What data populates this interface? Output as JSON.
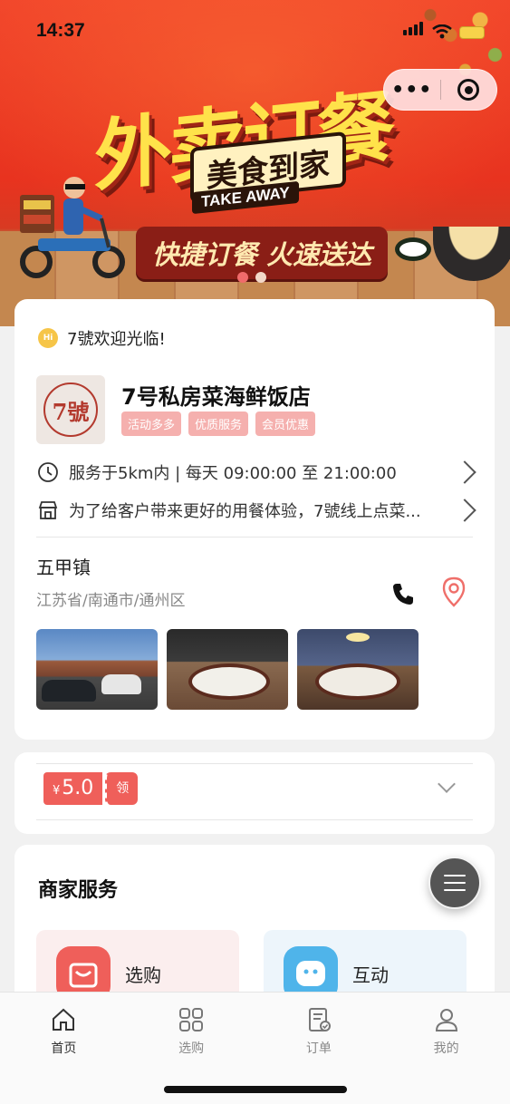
{
  "status_bar": {
    "time": "14:37"
  },
  "banner": {
    "title": "外卖订餐",
    "subtitle": "美食到家",
    "tagline_en": "TAKE AWAY",
    "slogan": "快捷订餐  火速送达",
    "dots": 2,
    "active_dot": 0
  },
  "capsule": {
    "more_label": "•••"
  },
  "shop": {
    "welcome": "7號欢迎光临!",
    "welcome_icon": "hi-bubble-icon",
    "logo_text": "7號",
    "name": "7号私房菜海鲜饭店",
    "tags": [
      "活动多多",
      "优质服务",
      "会员优惠"
    ],
    "hours": "服务于5km内 | 每天 09:00:00 至 21:00:00",
    "notice": "为了给客户带来更好的用餐体验，7號线上点菜...",
    "town": "五甲镇",
    "address": "江苏省/南通市/通州区"
  },
  "coupon": {
    "currency": "¥",
    "amount": "5.0",
    "action": "领"
  },
  "services": {
    "title": "商家服务",
    "items": [
      {
        "label": "选购",
        "icon": "bag-icon"
      },
      {
        "label": "互动",
        "icon": "chat-face-icon"
      }
    ]
  },
  "tabbar": {
    "items": [
      {
        "label": "首页",
        "icon": "home-icon",
        "active": true
      },
      {
        "label": "选购",
        "icon": "grid-icon",
        "active": false
      },
      {
        "label": "订单",
        "icon": "order-icon",
        "active": false
      },
      {
        "label": "我的",
        "icon": "user-icon",
        "active": false
      }
    ]
  },
  "colors": {
    "accent": "#ef5f5a",
    "tag_bg": "#f5b0ae",
    "banner_red": "#e8331f"
  }
}
